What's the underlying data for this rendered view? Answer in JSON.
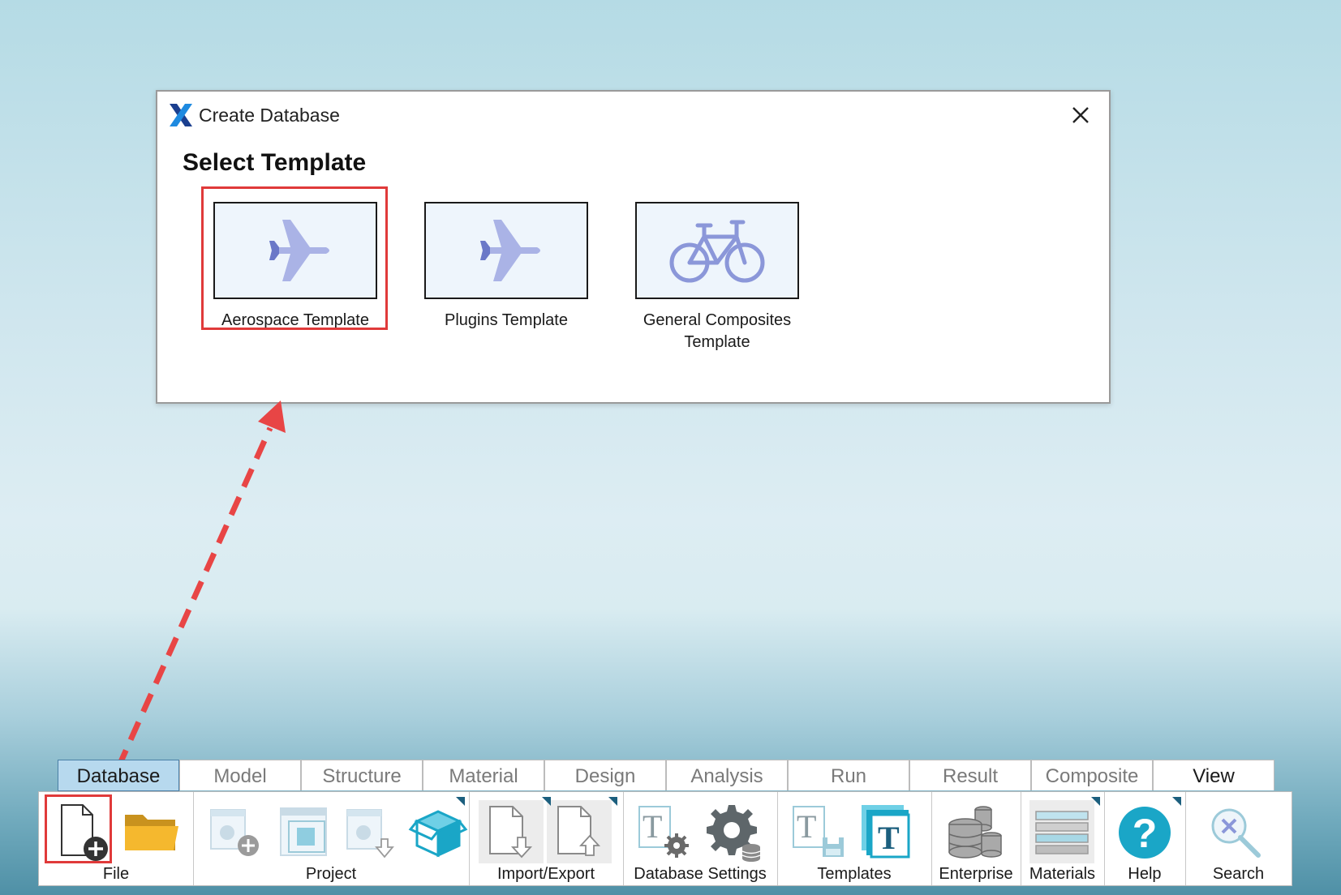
{
  "dialog": {
    "title": "Create Database",
    "heading": "Select Template",
    "templates": [
      {
        "label": "Aerospace Template",
        "icon": "airplane-icon"
      },
      {
        "label": "Plugins Template",
        "icon": "airplane-icon"
      },
      {
        "label": "General Composites Template",
        "icon": "bicycle-icon"
      }
    ]
  },
  "ribbon": {
    "tabs": [
      "Database",
      "Model",
      "Structure",
      "Material",
      "Design",
      "Analysis",
      "Run",
      "Result",
      "Composite",
      "View"
    ],
    "active_tab": "Database",
    "groups": {
      "file": "File",
      "project": "Project",
      "import_export": "Import/Export",
      "database_settings": "Database Settings",
      "templates": "Templates",
      "enterprise": "Enterprise",
      "materials": "Materials",
      "help": "Help",
      "search": "Search"
    }
  },
  "colors": {
    "highlight": "#e03a3a",
    "icon_blue": "#8b97d9",
    "teal": "#1aa6c7",
    "active_tab": "#b7d9ee"
  }
}
